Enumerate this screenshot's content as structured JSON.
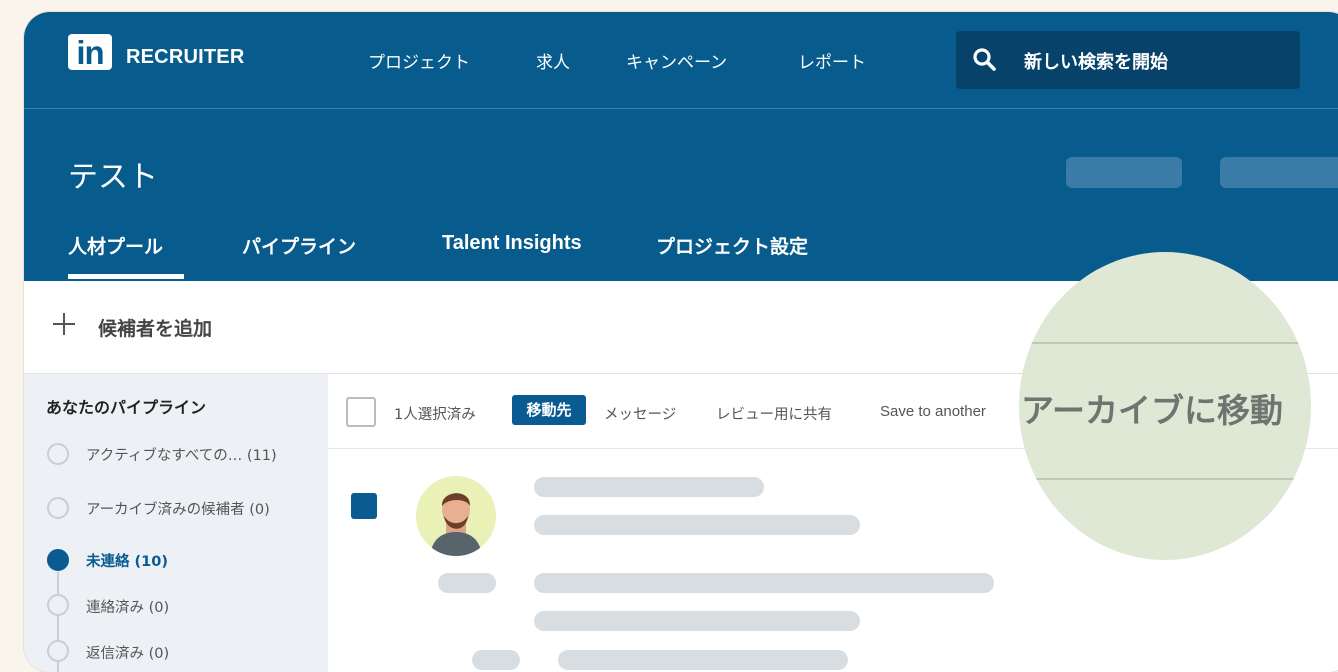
{
  "app": {
    "logo_text": "in",
    "brand": "RECRUITER"
  },
  "nav": [
    "プロジェクト",
    "求人",
    "キャンペーン",
    "レポート"
  ],
  "search": {
    "label": "新しい検索を開始",
    "icon": "search-icon"
  },
  "project": {
    "title": "テスト"
  },
  "tabs": [
    "人材プール",
    "パイプライン",
    "Talent Insights",
    "プロジェクト設定"
  ],
  "add_candidate": {
    "label": "候補者を追加",
    "icon": "plus-icon"
  },
  "sidebar": {
    "title": "あなたのパイプライン",
    "items": [
      {
        "label": "アクティブなすべての… (11)",
        "state": "empty"
      },
      {
        "label": "アーカイブ済みの候補者 (0)",
        "state": "empty"
      },
      {
        "label": "未連絡 (10)",
        "state": "selected"
      },
      {
        "label": "連絡済み (0)",
        "state": "empty"
      },
      {
        "label": "返信済み (0)",
        "state": "empty"
      }
    ]
  },
  "toolbar": {
    "selected_count": "1人選択済み",
    "move_to": "移動先",
    "message": "メッセージ",
    "share_review": "レビュー用に共有",
    "save_another": "Save to another",
    "archive_zoom": "アーカイブに移動"
  },
  "colors": {
    "brand_blue": "#085c8d",
    "search_bg": "#07426b",
    "accent": "#0a5b92",
    "sidebar_bg": "#edf1f5",
    "zoom_bg": "#dfe7d5",
    "page_bg": "#f9f4ec"
  }
}
